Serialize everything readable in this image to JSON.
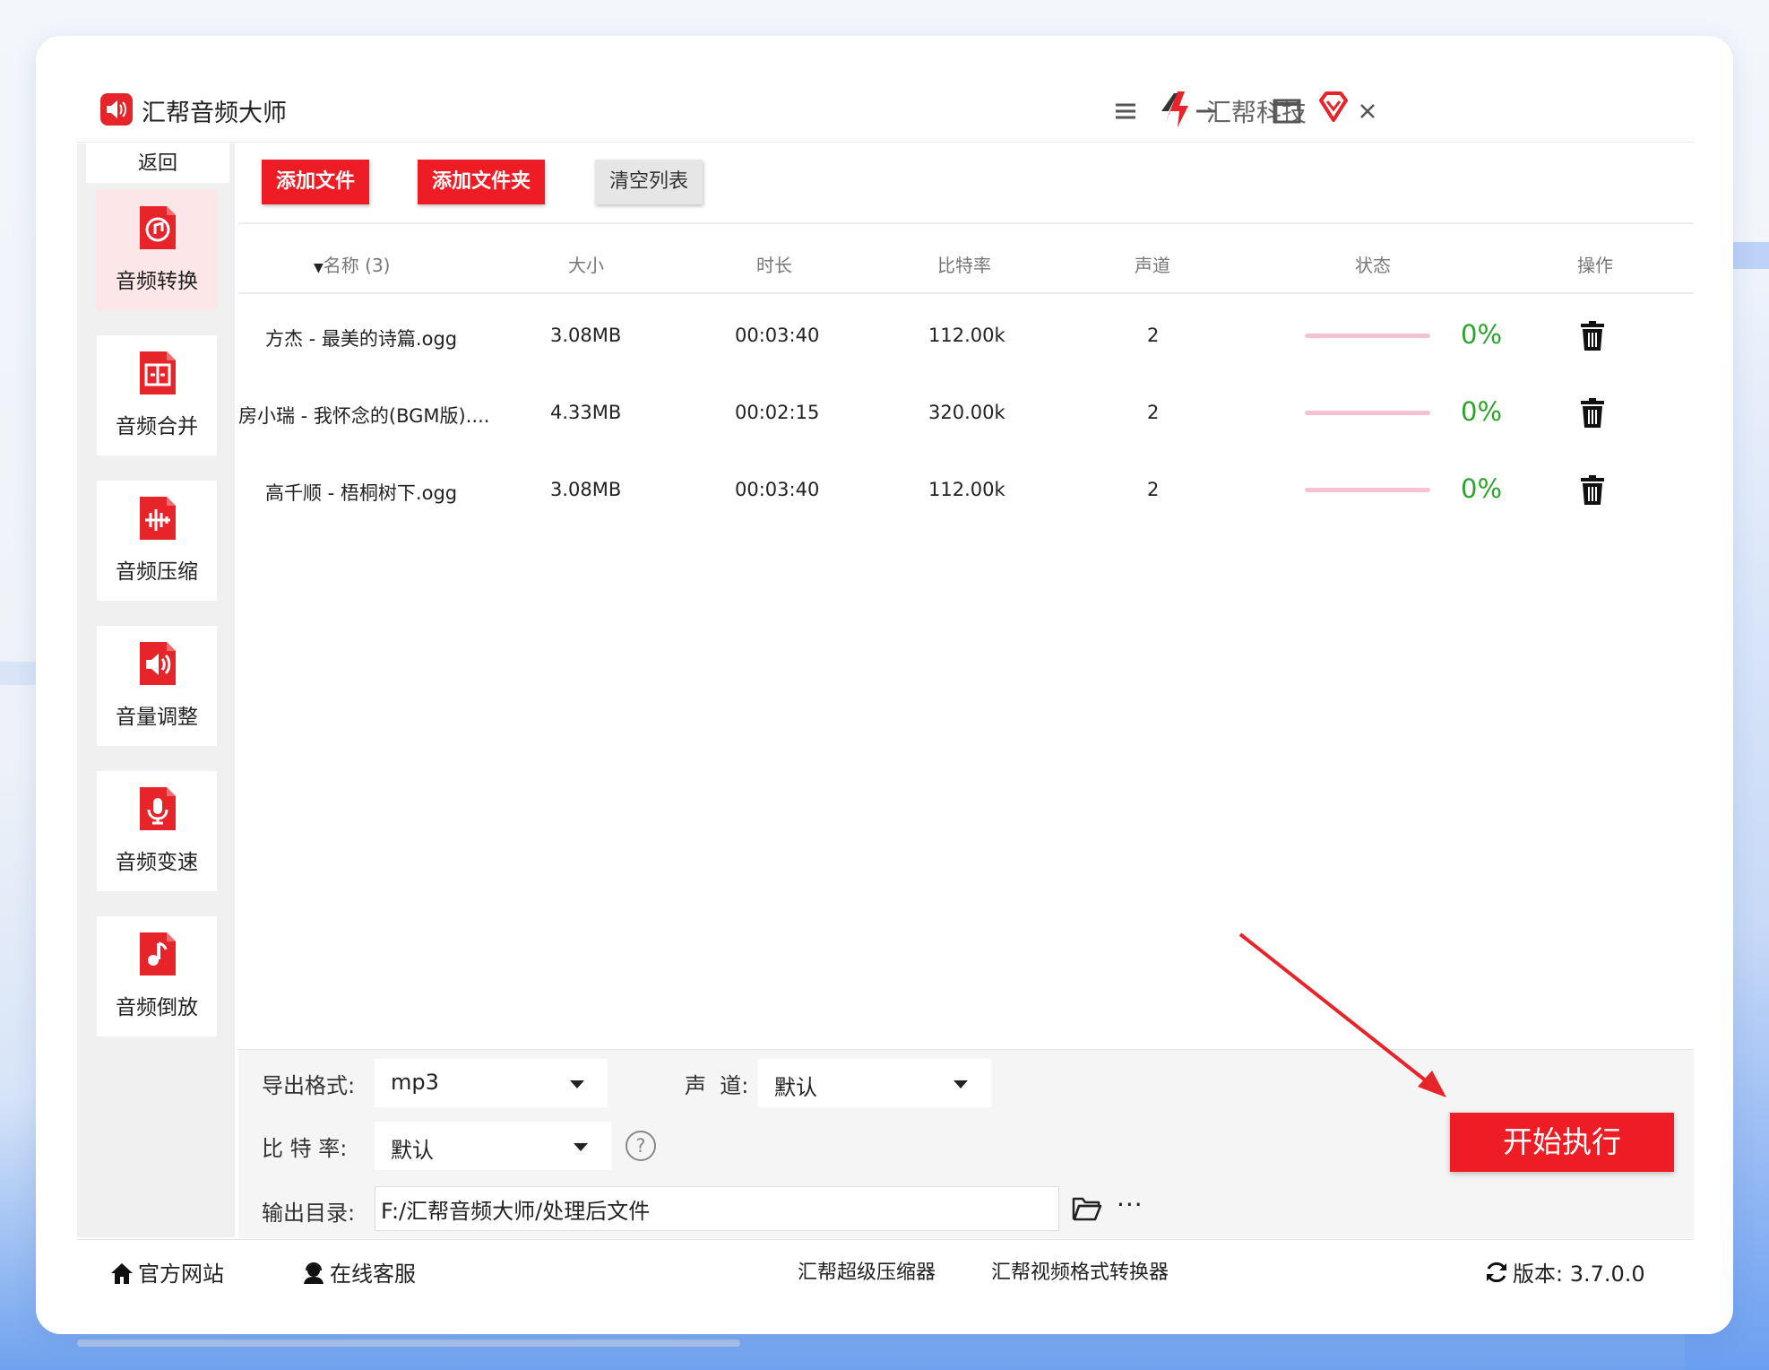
{
  "app": {
    "title": "汇帮音频大师",
    "brand": "汇帮科技"
  },
  "sidebar": {
    "back_label": "返回",
    "items": [
      {
        "label": "音频转换",
        "icon": "audio-convert-icon",
        "active": true
      },
      {
        "label": "音频合并",
        "icon": "audio-merge-icon",
        "active": false
      },
      {
        "label": "音频压缩",
        "icon": "audio-compress-icon",
        "active": false
      },
      {
        "label": "音量调整",
        "icon": "volume-icon",
        "active": false
      },
      {
        "label": "音频变速",
        "icon": "microphone-icon",
        "active": false
      },
      {
        "label": "音频倒放",
        "icon": "music-note-icon",
        "active": false
      }
    ]
  },
  "toolbar": {
    "add_file": "添加文件",
    "add_folder": "添加文件夹",
    "clear_list": "清空列表"
  },
  "table": {
    "headers": {
      "name": "名称 (3)",
      "size": "大小",
      "duration": "时长",
      "bitrate": "比特率",
      "channels": "声道",
      "status": "状态",
      "action": "操作"
    },
    "rows": [
      {
        "name": "方杰 - 最美的诗篇.ogg",
        "size": "3.08MB",
        "duration": "00:03:40",
        "bitrate": "112.00k",
        "channels": "2",
        "progress": "0%"
      },
      {
        "name": "房小瑞 - 我怀念的(BGM版)....",
        "size": "4.33MB",
        "duration": "00:02:15",
        "bitrate": "320.00k",
        "channels": "2",
        "progress": "0%"
      },
      {
        "name": "高千顺 - 梧桐树下.ogg",
        "size": "3.08MB",
        "duration": "00:03:40",
        "bitrate": "112.00k",
        "channels": "2",
        "progress": "0%"
      }
    ]
  },
  "settings": {
    "format_label": "导出格式:",
    "format_value": "mp3",
    "channel_label": "声  道:",
    "channel_value": "默认",
    "bitrate_label": "比 特 率:",
    "bitrate_value": "默认",
    "help_glyph": "?",
    "output_label": "输出目录:",
    "output_path": "F:/汇帮音频大师/处理后文件",
    "more_glyph": "···",
    "start_button": "开始执行"
  },
  "footer": {
    "website": "官方网站",
    "support": "在线客服",
    "compressor": "汇帮超级压缩器",
    "video_converter": "汇帮视频格式转换器",
    "version": "版本:  3.7.0.0"
  },
  "colors": {
    "accent": "#ee1c25",
    "progress_track": "#f7c2d0",
    "percent_text": "#2ca42c",
    "nav_active": "#fce6e7"
  }
}
